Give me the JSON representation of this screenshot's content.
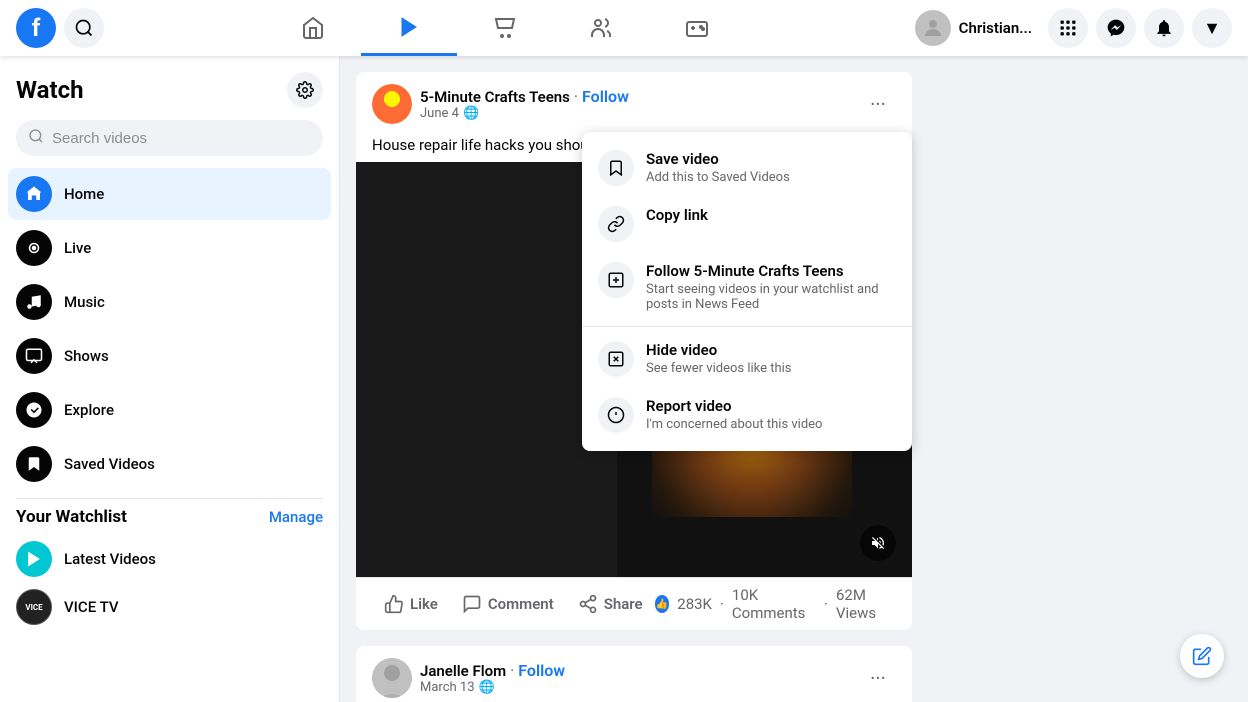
{
  "nav": {
    "logo": "f",
    "username": "Christian...",
    "icons": {
      "home": "home-icon",
      "watch": "watch-icon",
      "marketplace": "marketplace-icon",
      "groups": "groups-icon",
      "gaming": "gaming-icon"
    }
  },
  "sidebar": {
    "title": "Watch",
    "search_placeholder": "Search videos",
    "nav_items": [
      {
        "id": "home",
        "label": "Home",
        "icon": "home-nav-icon"
      },
      {
        "id": "live",
        "label": "Live",
        "icon": "live-icon"
      },
      {
        "id": "music",
        "label": "Music",
        "icon": "music-icon"
      },
      {
        "id": "shows",
        "label": "Shows",
        "icon": "shows-icon"
      },
      {
        "id": "explore",
        "label": "Explore",
        "icon": "explore-icon"
      },
      {
        "id": "saved",
        "label": "Saved Videos",
        "icon": "saved-icon"
      }
    ],
    "watchlist": {
      "title": "Your Watchlist",
      "manage_label": "Manage",
      "items": [
        {
          "id": "latest",
          "label": "Latest Videos"
        },
        {
          "id": "vice",
          "label": "VICE TV"
        }
      ]
    }
  },
  "post1": {
    "channel": "5-Minute Crafts Teens",
    "follow_label": "Follow",
    "date": "June 4",
    "privacy": "🌐",
    "text": "House repair life hacks you should know. 🔥",
    "more_icon": "•••",
    "stats": {
      "likes": "283K",
      "comments": "10K Comments",
      "views": "62M Views"
    },
    "actions": {
      "like": "Like",
      "comment": "Comment",
      "share": "Share"
    }
  },
  "post2": {
    "channel": "Janelle Flom",
    "follow_label": "Follow",
    "date": "March 13",
    "privacy": "🌐"
  },
  "dropdown": {
    "items": [
      {
        "id": "save",
        "title": "Save video",
        "subtitle": "Add this to Saved Videos",
        "icon": "bookmark-icon"
      },
      {
        "id": "copy",
        "title": "Copy link",
        "subtitle": "",
        "icon": "link-icon"
      },
      {
        "id": "follow",
        "title": "Follow 5-Minute Crafts Teens",
        "subtitle": "Start seeing videos in your watchlist and posts in News Feed",
        "icon": "follow-icon"
      },
      {
        "id": "hide",
        "title": "Hide video",
        "subtitle": "See fewer videos like this",
        "icon": "hide-icon"
      },
      {
        "id": "report",
        "title": "Report video",
        "subtitle": "I'm concerned about this video",
        "icon": "report-icon"
      }
    ]
  }
}
